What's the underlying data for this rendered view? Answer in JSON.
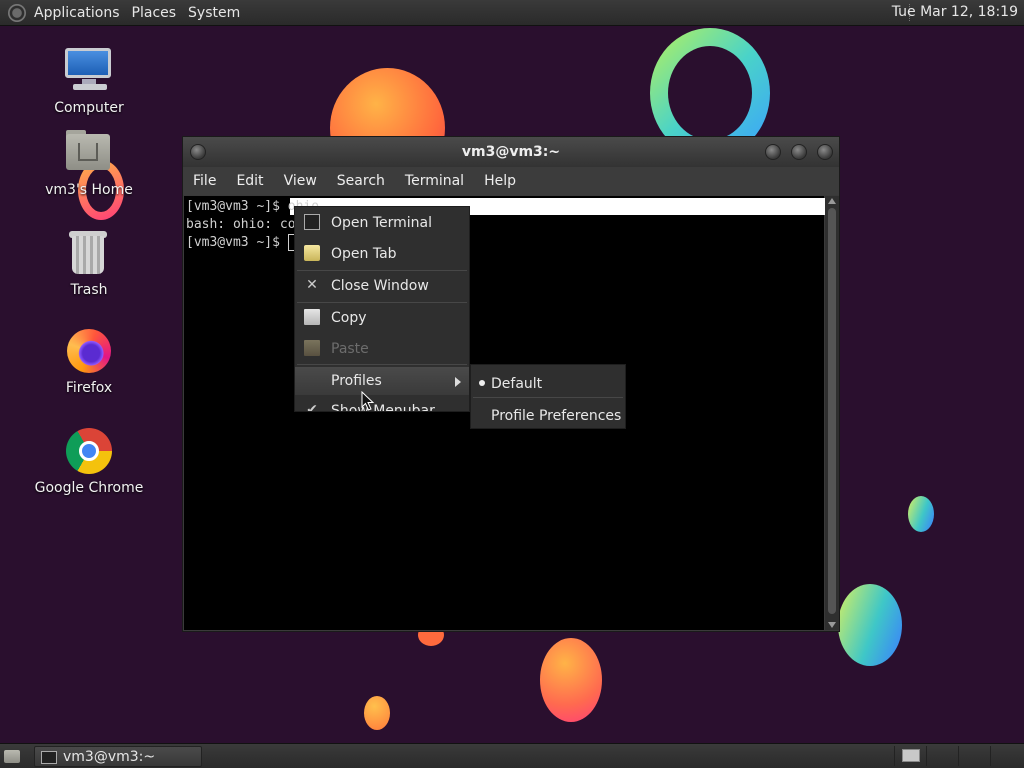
{
  "top_panel": {
    "menus": [
      "Applications",
      "Places",
      "System"
    ],
    "clock": "Tue Mar 12, 18:19"
  },
  "desktop_icons": [
    {
      "label": "Computer",
      "icon": "computer-icon"
    },
    {
      "label": "vm3's Home",
      "icon": "home-folder-icon"
    },
    {
      "label": "Trash",
      "icon": "trash-icon"
    },
    {
      "label": "Firefox",
      "icon": "firefox-icon"
    },
    {
      "label": "Google Chrome",
      "icon": "chrome-icon"
    }
  ],
  "terminal": {
    "title": "vm3@vm3:~",
    "menu": [
      "File",
      "Edit",
      "View",
      "Search",
      "Terminal",
      "Help"
    ],
    "lines": [
      "[vm3@vm3 ~]$ ohio",
      "bash: ohio: co",
      "[vm3@vm3 ~]$ "
    ]
  },
  "context_menu": {
    "items": [
      {
        "label": "Open Terminal",
        "icon": "terminal-icon",
        "enabled": true
      },
      {
        "label": "Open Tab",
        "icon": "new-tab-icon",
        "enabled": true
      },
      {
        "label": "Close Window",
        "icon": "close-icon",
        "enabled": true
      },
      {
        "label": "Copy",
        "icon": "copy-icon",
        "enabled": true
      },
      {
        "label": "Paste",
        "icon": "paste-icon",
        "enabled": false
      },
      {
        "label": "Profiles",
        "icon": "",
        "enabled": true,
        "has_submenu": true
      },
      {
        "label": "Show Menubar",
        "icon": "checkmark-icon",
        "enabled": true,
        "checked": true
      }
    ]
  },
  "profiles_submenu": {
    "items": [
      {
        "label": "Default",
        "selected": true
      },
      {
        "label": "Profile Preferences",
        "selected": false
      }
    ]
  },
  "bottom_panel": {
    "taskbar": [
      {
        "label": "vm3@vm3:~"
      }
    ]
  },
  "colors": {
    "desktop_bg": "#2a0f2e",
    "panel_bg": "#333333",
    "menu_bg": "#2f2f2f",
    "terminal_bg": "#000000"
  }
}
